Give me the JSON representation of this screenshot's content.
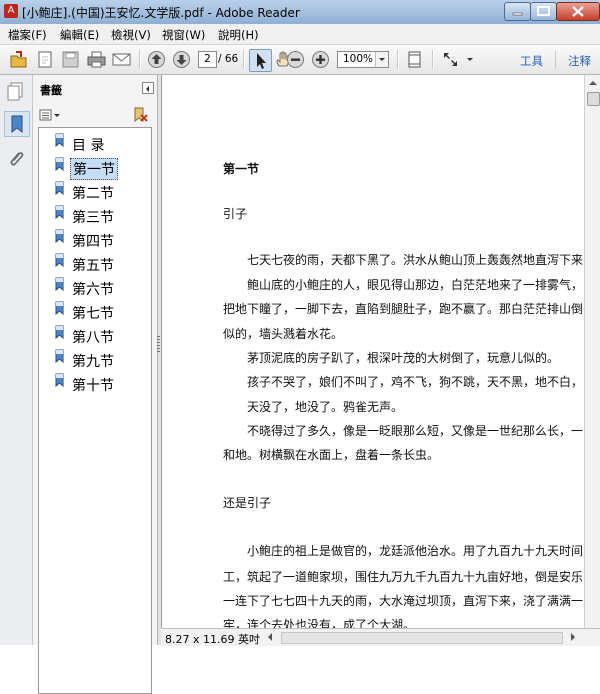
{
  "window": {
    "title": "[小鲍庄].(中国)王安忆.文学版.pdf - Adobe Reader",
    "app_icon": "adobe-reader-icon"
  },
  "menu": [
    "檔案(F)",
    "編輯(E)",
    "檢視(V)",
    "視窗(W)",
    "說明(H)"
  ],
  "toolbar": {
    "page_current": "2",
    "page_total": "/ 66",
    "zoom": "100%",
    "tools_link": "工具",
    "comment_link": "注释"
  },
  "bookmarks": {
    "title": "書籤",
    "items": [
      {
        "label": "目 录"
      },
      {
        "label": "第一节",
        "selected": true
      },
      {
        "label": "第二节"
      },
      {
        "label": "第三节"
      },
      {
        "label": "第四节"
      },
      {
        "label": "第五节"
      },
      {
        "label": "第六节"
      },
      {
        "label": "第七节"
      },
      {
        "label": "第八节"
      },
      {
        "label": "第九节"
      },
      {
        "label": "第十节"
      }
    ]
  },
  "document": {
    "heading": "第一节",
    "sub1": "引子",
    "lines": [
      "七天七夜的雨，天都下黑了。洪水从鲍山顶上轰轰然地直泻下来，",
      "鲍山底的小鲍庄的人，眼见得山那边，白茫茫地来了一排雾气，",
      "把地下瞳了，一脚下去，直陷到腿肚子，跑不赢了。那白茫茫排山倒",
      "似的，墙头溅着水花。",
      "茅顶泥底的房子趴了，根深叶茂的大树倒了，玩意儿似的。",
      "孩子不哭了，娘们不叫了，鸡不飞，狗不跳，天不黑，地不白，",
      "天没了，地没了。鸦雀无声。",
      "不晓得过了多久，像是一眨眼那么短，又像是一世纪那么长，一",
      "和地。树横飘在水面上，盘着一条长虫。"
    ],
    "sub2": "还是引子",
    "lines2": [
      "小鲍庄的祖上是做官的，龙廷派他治水。用了九百九十九天时间",
      "工，筑起了一道鲍家坝，围住九万九千九百九十九亩好地，倒是安乐",
      "一连下了七七四十九天的雨，大水淹过坝顶，直泻下来，浇了满满一",
      "牢，连个去处也没有，成了个大湖。"
    ]
  },
  "status": {
    "page_size": "8.27 x 11.69 英吋"
  }
}
